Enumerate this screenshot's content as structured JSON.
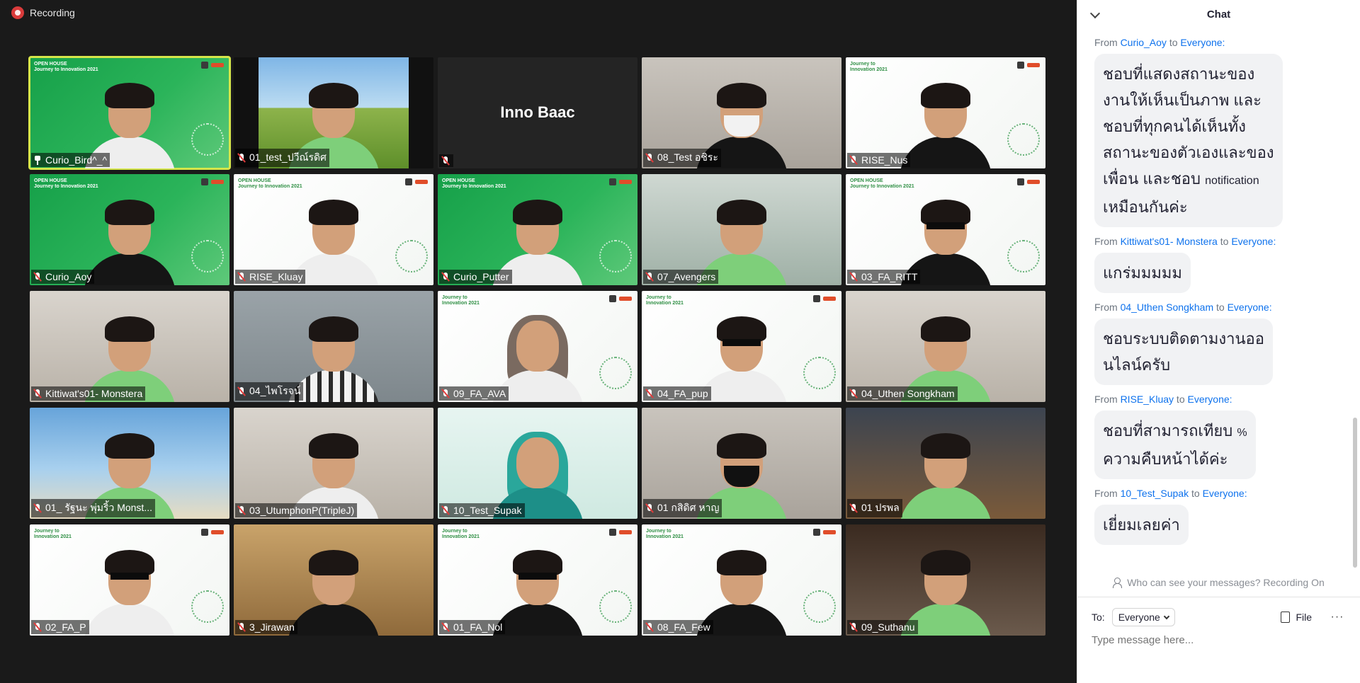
{
  "recording": {
    "label": "Recording"
  },
  "tiles": [
    {
      "name": "Curio_Bird^_^",
      "bg": "green",
      "active": true,
      "pinned": true,
      "banner": "OPEN HOUSE\nJourney to Innovation 2021",
      "body": "white"
    },
    {
      "name": "01_test_ปวีณ์รดิศ",
      "bg": "field",
      "body": "green"
    },
    {
      "name": "",
      "bg": "dark",
      "center": "Inno Baac"
    },
    {
      "name": "08_Test อชิระ",
      "bg": "room1",
      "body": "black",
      "mask": "white"
    },
    {
      "name": "RISE_Nus",
      "bg": "white",
      "banner": "Journey to\nInnovation 2021",
      "body": "black"
    },
    {
      "name": "Curio_Aoy",
      "bg": "green",
      "banner": "OPEN HOUSE\nJourney to Innovation 2021",
      "body": "black"
    },
    {
      "name": "RISE_Kluay",
      "bg": "white",
      "banner": "OPEN HOUSE\nJourney to Innovation 2021",
      "body": "white"
    },
    {
      "name": "Curio_Putter",
      "bg": "green",
      "banner": "OPEN HOUSE\nJourney to Innovation 2021",
      "body": "white"
    },
    {
      "name": "07_Avengers",
      "bg": "office",
      "body": "green"
    },
    {
      "name": "03_FA_RITT",
      "bg": "white",
      "banner": "OPEN HOUSE\nJourney to Innovation 2021",
      "body": "black",
      "glasses": true
    },
    {
      "name": "Kittiwat's01- Monstera",
      "bg": "room3",
      "body": "green"
    },
    {
      "name": "04_ไพโรจน์",
      "bg": "room2",
      "body": "stripe"
    },
    {
      "name": "09_FA_AVA",
      "bg": "white",
      "banner": "Journey to\nInnovation 2021",
      "body": "white",
      "hijab": "brown"
    },
    {
      "name": "04_FA_pup",
      "bg": "white",
      "banner": "Journey to\nInnovation 2021",
      "body": "white",
      "glasses": true
    },
    {
      "name": "04_Uthen Songkham",
      "bg": "room3",
      "body": "green"
    },
    {
      "name": "01_ รัฐนะ พุ่มริ้ว Monst...",
      "bg": "beach",
      "body": "green"
    },
    {
      "name": "03_UtumphonP(TripleJ)",
      "bg": "room3",
      "body": "white"
    },
    {
      "name": "10_Test_Supak",
      "bg": "teal",
      "body": "teal",
      "hijab": "teal"
    },
    {
      "name": "01 กสิดิศ หาญ",
      "bg": "room1",
      "body": "green",
      "mask": "black"
    },
    {
      "name": "01 ปรพล",
      "bg": "cafe",
      "body": "green"
    },
    {
      "name": "02_FA_P",
      "bg": "white",
      "banner": "Journey to\nInnovation 2021",
      "body": "white",
      "glasses": true
    },
    {
      "name": "3_Jirawan",
      "bg": "warm",
      "body": "black"
    },
    {
      "name": "01_FA_Nol",
      "bg": "white",
      "banner": "Journey to\nInnovation 2021",
      "body": "black",
      "glasses": true
    },
    {
      "name": "08_FA_Few",
      "bg": "white",
      "banner": "Journey to\nInnovation 2021",
      "body": "black"
    },
    {
      "name": "09_Suthanu",
      "bg": "ceiling",
      "body": "green"
    }
  ],
  "chat": {
    "title": "Chat",
    "from_word": "From",
    "to_word": "to",
    "messages": [
      {
        "sender": "Curio_Aoy",
        "recipient": "Everyone:",
        "lines": [
          "ชอบที่แสดงสถานะของ",
          "งานให้เห็นเป็นภาพ และ",
          "ชอบที่ทุกคนได้เห็นทั้ง",
          "สถานะของตัวเองและของ",
          "เพื่อน และชอบ <s>notification</s>",
          "เหมือนกันค่ะ"
        ]
      },
      {
        "sender": "Kittiwat's01- Monstera",
        "recipient": "Everyone:",
        "lines": [
          "แกร่มมมมม"
        ]
      },
      {
        "sender": "04_Uthen Songkham",
        "recipient": "Everyone:",
        "lines": [
          "ชอบระบบติดตามงานออ",
          "นไลน์ครับ"
        ]
      },
      {
        "sender": "RISE_Kluay",
        "recipient": "Everyone:",
        "lines": [
          "ชอบที่สามารถเทียบ <s>%</s>",
          "ความคืบหน้าได้ค่ะ"
        ]
      },
      {
        "sender": "10_Test_Supak",
        "recipient": "Everyone:",
        "lines": [
          "เยี่ยมเลยค่า"
        ]
      }
    ],
    "visibility_note": "Who can see your messages? Recording On",
    "to_label": "To:",
    "to_value": "Everyone",
    "file_label": "File",
    "more_label": "···",
    "input_placeholder": "Type message here..."
  }
}
